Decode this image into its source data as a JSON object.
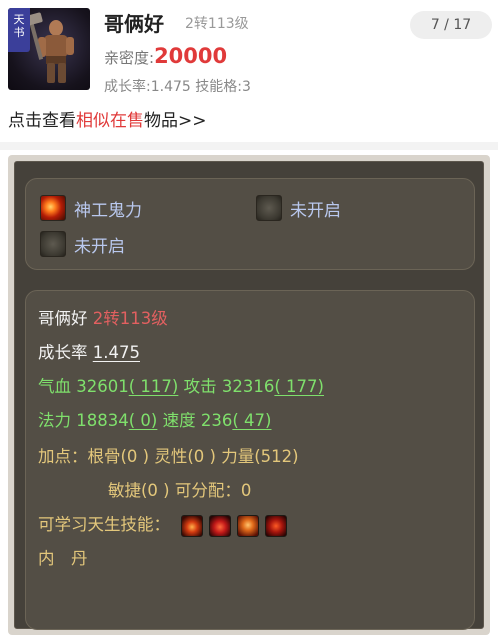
{
  "header": {
    "tag": [
      "天",
      "书"
    ],
    "pet_name": "哥俩好",
    "pet_level": "2转113级",
    "pager": "7 / 17",
    "intimacy_label": "亲密度:",
    "intimacy_value": "20000",
    "growth_rate_label": "成长率:1.475",
    "skill_slots_label": "技能格:3",
    "similar_prefix": "点击查看",
    "similar_link": "相似在售",
    "similar_suffix": "物品>>"
  },
  "skills_box": {
    "skill1": "神工鬼力",
    "skill2": "未开启",
    "skill3": "未开启"
  },
  "stats": {
    "name": "哥俩好",
    "level": "2转113级",
    "growth_label": "成长率",
    "growth_value": "1.475",
    "hp_label": "气血",
    "hp_value": "32601",
    "hp_bonus": "( 117)",
    "atk_label": "攻击",
    "atk_value": "32316",
    "atk_bonus": "( 177)",
    "mp_label": "法力",
    "mp_value": "18834",
    "mp_bonus": "( 0)",
    "spd_label": "速度",
    "spd_value": "236",
    "spd_bonus": "( 47)",
    "points_line1": "加点：根骨(0 ) 灵性(0 ) 力量(512)",
    "points_line2": "敏捷(0 ) 可分配：0",
    "innate_label": "可学习天生技能：",
    "neidan_label": "内　丹"
  },
  "colors": {
    "accent_red": "#e03a3a",
    "stat_green": "#7fe06c",
    "points_gold": "#e3c77b",
    "tag_blue": "#3b3f9a"
  }
}
